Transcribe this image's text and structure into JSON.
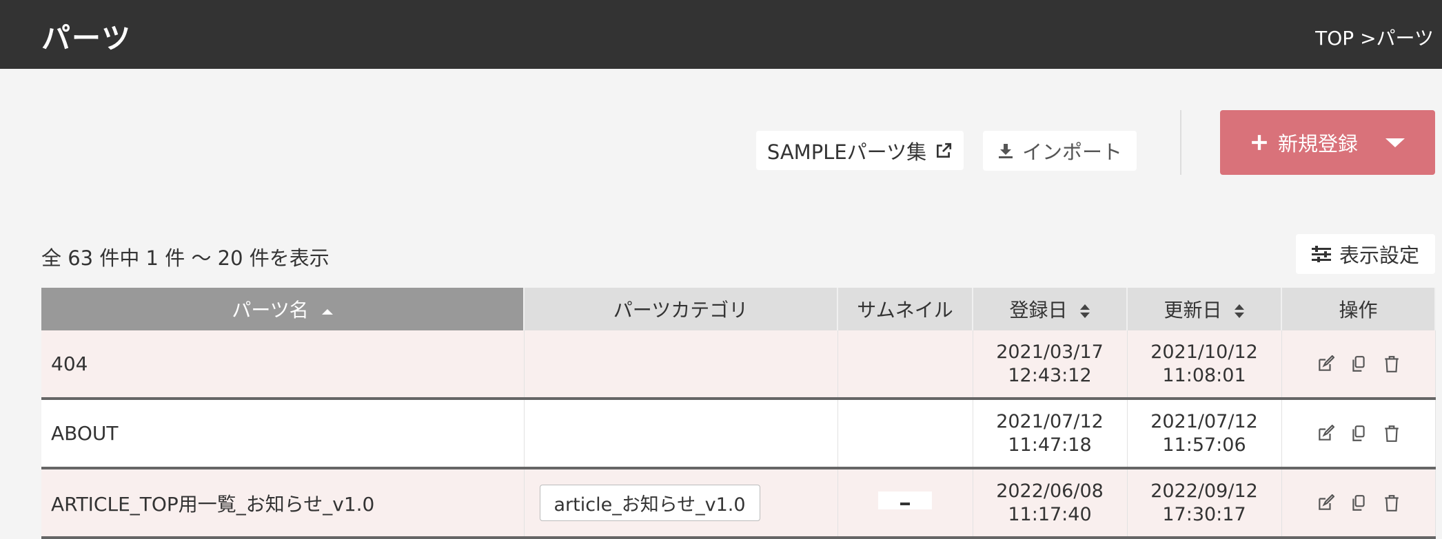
{
  "header": {
    "title": "パーツ",
    "breadcrumb": "TOP >パーツ"
  },
  "toolbar": {
    "sample_label": "SAMPLEパーツ集",
    "import_label": "インポート",
    "new_label": "新規登録"
  },
  "list": {
    "count_text": "全 63 件中 1 件 〜 20 件を表示",
    "display_settings_label": "表示設定"
  },
  "table": {
    "headers": {
      "name": "パーツ名",
      "category": "パーツカテゴリ",
      "thumbnail": "サムネイル",
      "created": "登録日",
      "updated": "更新日",
      "actions": "操作"
    },
    "rows": [
      {
        "name": "404",
        "category": "",
        "created_date": "2021/03/17",
        "created_time": "12:43:12",
        "updated_date": "2021/10/12",
        "updated_time": "11:08:01"
      },
      {
        "name": "ABOUT",
        "category": "",
        "created_date": "2021/07/12",
        "created_time": "11:47:18",
        "updated_date": "2021/07/12",
        "updated_time": "11:57:06"
      },
      {
        "name": "ARTICLE_TOP用一覧_お知らせ_v1.0",
        "category": "article_お知らせ_v1.0",
        "created_date": "2022/06/08",
        "created_time": "11:17:40",
        "updated_date": "2022/09/12",
        "updated_time": "17:30:17"
      }
    ]
  },
  "colors": {
    "topbar": "#333333",
    "accent": "#d9727a",
    "row_pink": "#f9efee",
    "sorted_header": "#999999"
  }
}
